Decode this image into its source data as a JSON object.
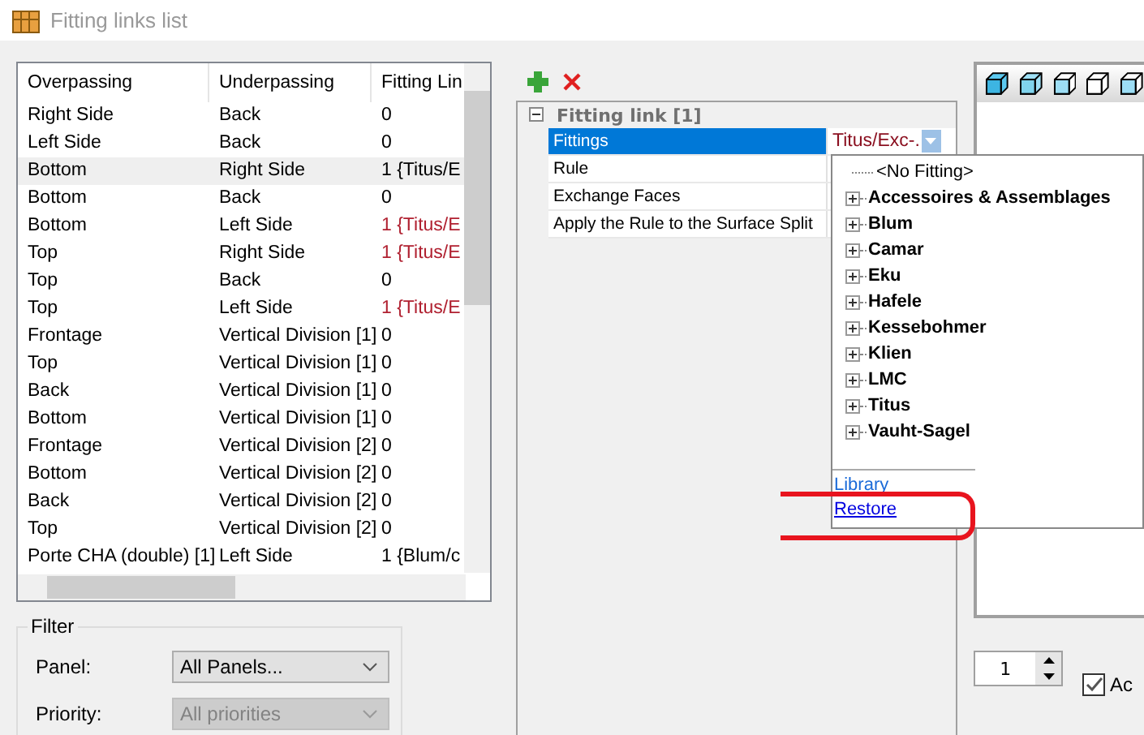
{
  "window": {
    "title": "Fitting links list"
  },
  "table": {
    "columns": [
      "Overpassing",
      "Underpassing",
      "Fitting Lin"
    ],
    "rows": [
      {
        "cells": [
          "Right Side",
          "Back",
          "0"
        ],
        "selected": false,
        "flagged": false
      },
      {
        "cells": [
          "Left Side",
          "Back",
          "0"
        ],
        "selected": false,
        "flagged": false
      },
      {
        "cells": [
          "Bottom",
          "Right Side",
          "1 {Titus/E"
        ],
        "selected": true,
        "flagged": false
      },
      {
        "cells": [
          "Bottom",
          "Back",
          "0"
        ],
        "selected": false,
        "flagged": false
      },
      {
        "cells": [
          "Bottom",
          "Left Side",
          "1 {Titus/E"
        ],
        "selected": false,
        "flagged": true
      },
      {
        "cells": [
          "Top",
          "Right Side",
          "1 {Titus/E"
        ],
        "selected": false,
        "flagged": true
      },
      {
        "cells": [
          "Top",
          "Back",
          "0"
        ],
        "selected": false,
        "flagged": false
      },
      {
        "cells": [
          "Top",
          "Left Side",
          "1 {Titus/E"
        ],
        "selected": false,
        "flagged": true
      },
      {
        "cells": [
          "Frontage",
          "Vertical Division [1]",
          "0"
        ],
        "selected": false,
        "flagged": false
      },
      {
        "cells": [
          "Top",
          "Vertical Division [1]",
          "0"
        ],
        "selected": false,
        "flagged": false
      },
      {
        "cells": [
          "Back",
          "Vertical Division [1]",
          "0"
        ],
        "selected": false,
        "flagged": false
      },
      {
        "cells": [
          "Bottom",
          "Vertical Division [1]",
          "0"
        ],
        "selected": false,
        "flagged": false
      },
      {
        "cells": [
          "Frontage",
          "Vertical Division [2]",
          "0"
        ],
        "selected": false,
        "flagged": false
      },
      {
        "cells": [
          "Bottom",
          "Vertical Division [2]",
          "0"
        ],
        "selected": false,
        "flagged": false
      },
      {
        "cells": [
          "Back",
          "Vertical Division [2]",
          "0"
        ],
        "selected": false,
        "flagged": false
      },
      {
        "cells": [
          "Top",
          "Vertical Division [2]",
          "0"
        ],
        "selected": false,
        "flagged": false
      },
      {
        "cells": [
          "Porte CHA (double) [1]",
          "Left Side",
          "1 {Blum/c"
        ],
        "selected": false,
        "flagged": false
      }
    ]
  },
  "filter": {
    "title": "Filter",
    "fields": [
      {
        "label": "Panel:",
        "value": "All Panels...",
        "disabled": false
      },
      {
        "label": "Priority:",
        "value": "All priorities",
        "disabled": true
      }
    ]
  },
  "properties": {
    "category": "Fitting link [1]",
    "expanded": true,
    "rows": [
      {
        "name": "Fittings",
        "value": "Titus/Exc-.",
        "selected": true
      },
      {
        "name": "Rule",
        "selected": false
      },
      {
        "name": "Exchange Faces",
        "selected": false
      },
      {
        "name": "Apply the Rule to the Surface Split",
        "selected": false
      }
    ]
  },
  "dropdown": {
    "items": [
      {
        "label": "<No Fitting>",
        "kind": "leaf"
      },
      {
        "label": "Accessoires & Assemblages",
        "kind": "group"
      },
      {
        "label": "Blum",
        "kind": "group"
      },
      {
        "label": "Camar",
        "kind": "group"
      },
      {
        "label": "Eku",
        "kind": "group"
      },
      {
        "label": "Hafele",
        "kind": "group"
      },
      {
        "label": "Kessebohmer",
        "kind": "group"
      },
      {
        "label": "Klien",
        "kind": "group"
      },
      {
        "label": "LMC",
        "kind": "group"
      },
      {
        "label": "Titus",
        "kind": "group"
      },
      {
        "label": "Vauht-Sagel",
        "kind": "group"
      }
    ],
    "links": [
      "Library",
      "Restore"
    ]
  },
  "spinner": {
    "value": "1"
  },
  "checkbox": {
    "label": "Ac",
    "checked": true
  }
}
